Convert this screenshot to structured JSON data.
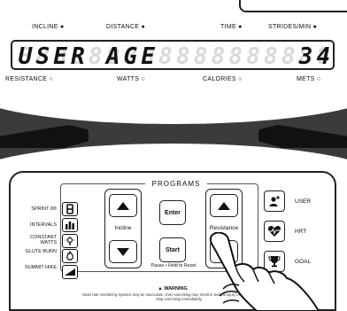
{
  "readout_labels": {
    "incline": "INCLINE",
    "distance": "DISTANCE",
    "time": "TIME",
    "strides_min": "STRIDES/MIN",
    "resistance": "RESISTANCE",
    "watts": "WATTS",
    "calories": "CALORIES",
    "mets": "METS"
  },
  "display": {
    "text": "USER AGE",
    "value": "34",
    "ghost_char": "8"
  },
  "programs": {
    "title": "PROGRAMS",
    "items": [
      {
        "label": "SPRINT 8®",
        "icon": "sprint-8-icon"
      },
      {
        "label": "INTERVALS",
        "icon": "intervals-icon"
      },
      {
        "label": "CONSTANT WATTS",
        "icon": "constant-watts-icon"
      },
      {
        "label": "GLUTE BURN",
        "icon": "glute-burn-icon"
      },
      {
        "label": "SUMMIT HIKE",
        "icon": "summit-hike-icon"
      }
    ]
  },
  "controls": {
    "incline_label": "Incline",
    "enter_label": "Enter",
    "start_label": "Start",
    "pause_hint": "Pause • Hold to Reset",
    "resistance_label": "Resistance"
  },
  "right_buttons": {
    "user": "USER",
    "hrt": "HRT",
    "goal": "GOAL"
  },
  "warning": {
    "title": "▲ WARNING",
    "text": "Heart rate monitoring systems may be inaccurate. Over exercising may result in serious injury or death. If you feel faint stop exercising immediately."
  }
}
